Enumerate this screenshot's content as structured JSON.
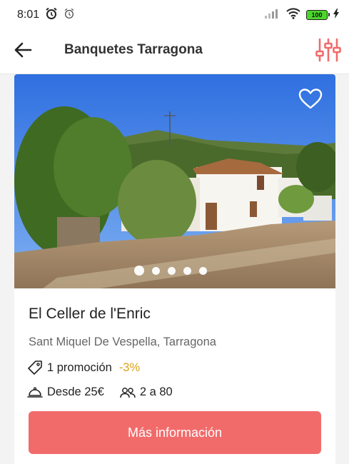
{
  "status_bar": {
    "time": "8:01",
    "battery_level": "100",
    "icons": [
      "alarm-icon",
      "alarm-outline-icon",
      "signal-icon",
      "wifi-icon",
      "battery-icon",
      "charging-icon"
    ]
  },
  "header": {
    "title": "Banquetes Tarragona",
    "back_icon": "arrow-left-icon",
    "filter_icon": "sliders-icon",
    "accent_color": "#f26b6b"
  },
  "listing": {
    "name": "El Celler de l'Enric",
    "location": "Sant Miquel De Vespella, Tarragona",
    "promotion_text": "1 promoción",
    "promotion_discount": "-3%",
    "price_text": "Desde 25€",
    "guests_text": "2 a 80",
    "cta_label": "Más información",
    "favorite_icon": "heart-outline-icon",
    "carousel": {
      "total_images": 5,
      "active_index": 0
    }
  }
}
